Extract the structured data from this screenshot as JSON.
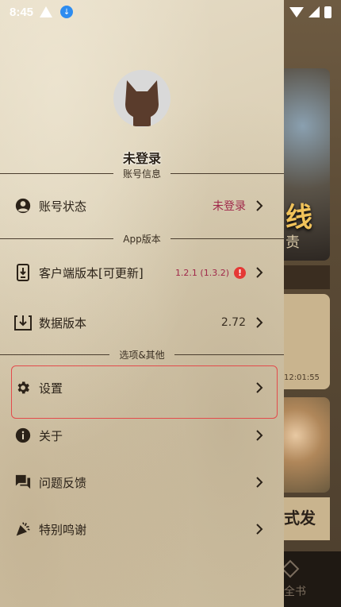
{
  "status_bar": {
    "time": "8:45"
  },
  "background_app": {
    "card1_title": "线",
    "card1_sub": "责",
    "card2_time": "12:01:55",
    "card3_title": "式发",
    "bottom_tab_label": "全书"
  },
  "drawer": {
    "username": "未登录",
    "sections": {
      "account": "账号信息",
      "app_version": "App版本",
      "options": "选项&其他"
    },
    "items": {
      "account_status": {
        "label": "账号状态",
        "value": "未登录",
        "icon": "account-circle-icon"
      },
      "client_version": {
        "label": "客户端版本[可更新]",
        "value": "1.2.1 (1.3.2)",
        "badge": "!",
        "icon": "phone-download-icon"
      },
      "data_version": {
        "label": "数据版本",
        "value": "2.72",
        "icon": "download-box-icon"
      },
      "settings": {
        "label": "设置",
        "icon": "gear-icon"
      },
      "about": {
        "label": "关于",
        "icon": "info-icon"
      },
      "feedback": {
        "label": "问题反馈",
        "icon": "feedback-icon"
      },
      "thanks": {
        "label": "特别鸣谢",
        "icon": "party-popper-icon"
      }
    }
  },
  "colors": {
    "accent_pink": "#a0284a",
    "badge_red": "#e53935",
    "highlight_border": "#e34b4b"
  }
}
